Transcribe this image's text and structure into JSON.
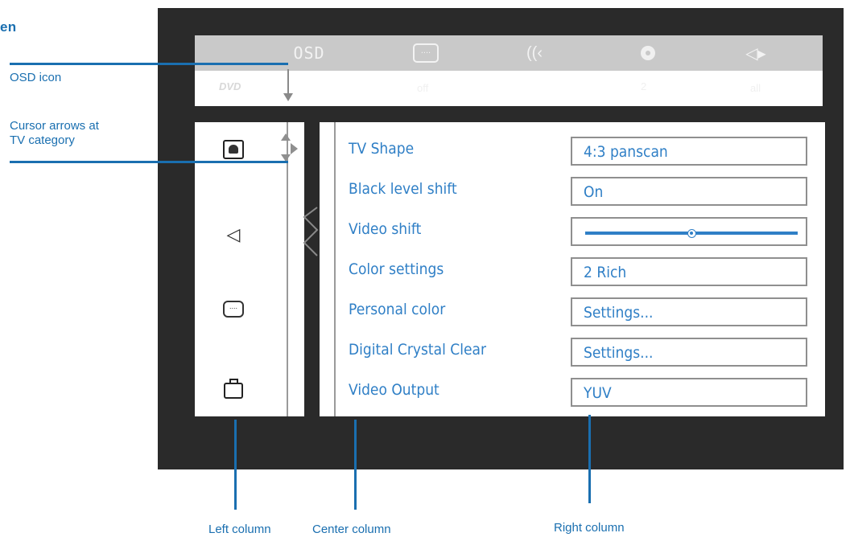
{
  "doc": {
    "heading": "en"
  },
  "topbar": {
    "osd_label": "OSD",
    "subtitle_glyph": "....",
    "audio_glyph": "((‹",
    "speaker_glyph": "◁▸"
  },
  "statusbar": {
    "disc_type": "DVD",
    "s1": "off",
    "s2": "2",
    "s3": "all"
  },
  "categories": [
    {
      "name": "TV",
      "icon": "tv-icon"
    },
    {
      "name": "Audio",
      "icon": "speaker-icon"
    },
    {
      "name": "Subtitle",
      "icon": "speech-bubble-icon",
      "glyph": "...."
    },
    {
      "name": "Misc",
      "icon": "briefcase-icon"
    }
  ],
  "audio_glyph": "◁",
  "settings": [
    {
      "label": "TV Shape",
      "value": "4:3 panscan"
    },
    {
      "label": "Black level shift",
      "value": "On"
    },
    {
      "label": "Video shift",
      "value": "",
      "slider": 0.5
    },
    {
      "label": "Color settings",
      "value": "2 Rich"
    },
    {
      "label": "Personal color",
      "value": "Settings..."
    },
    {
      "label": "Digital Crystal Clear",
      "value": "Settings..."
    },
    {
      "label": "Video Output",
      "value": "YUV"
    }
  ],
  "callouts": {
    "osd_icon": "OSD icon",
    "cursor_line1": "Cursor arrows at",
    "cursor_line2": "TV category",
    "left_column": "Left column",
    "center_column": "Center column",
    "right_column": "Right column"
  },
  "colors": {
    "accent": "#2f7fc6",
    "callout": "#1a6fb0",
    "screen_bg": "#2a2a2a",
    "bar": "#c9c9c9"
  }
}
